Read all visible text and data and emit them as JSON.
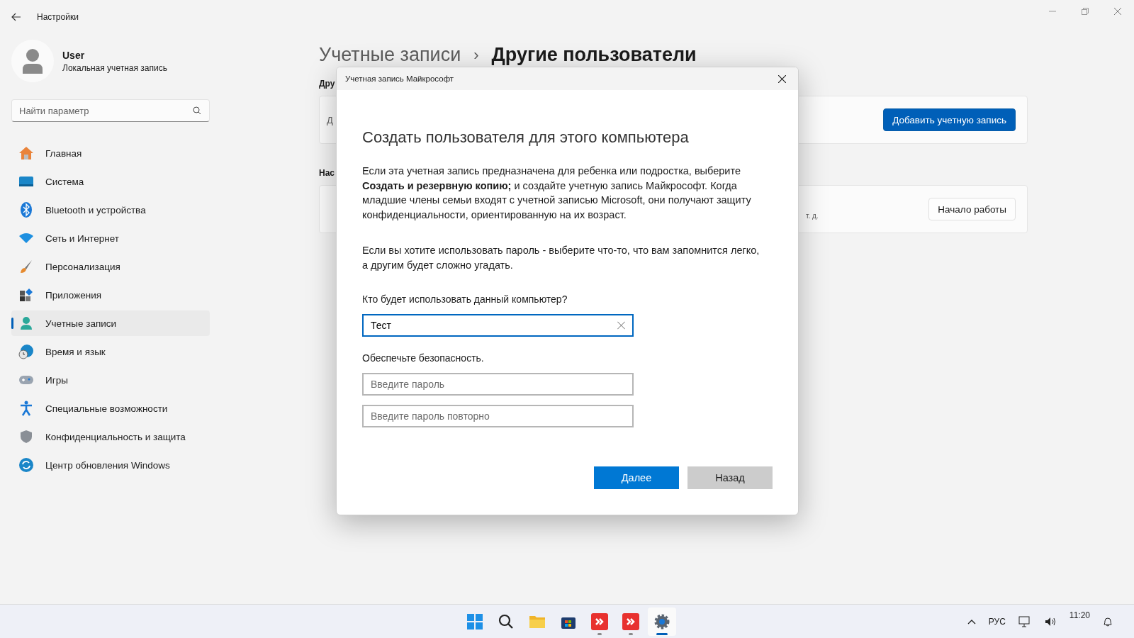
{
  "window": {
    "title": "Настройки"
  },
  "user": {
    "name": "User",
    "account_type": "Локальная учетная запись"
  },
  "search": {
    "placeholder": "Найти параметр"
  },
  "sidebar": {
    "items": [
      {
        "label": "Главная",
        "selected": false
      },
      {
        "label": "Система",
        "selected": false
      },
      {
        "label": "Bluetooth и устройства",
        "selected": false
      },
      {
        "label": "Сеть и Интернет",
        "selected": false
      },
      {
        "label": "Персонализация",
        "selected": false
      },
      {
        "label": "Приложения",
        "selected": false
      },
      {
        "label": "Учетные записи",
        "selected": true
      },
      {
        "label": "Время и язык",
        "selected": false
      },
      {
        "label": "Игры",
        "selected": false
      },
      {
        "label": "Специальные возможности",
        "selected": false
      },
      {
        "label": "Конфиденциальность и защита",
        "selected": false
      },
      {
        "label": "Центр обновления Windows",
        "selected": false
      }
    ]
  },
  "breadcrumb": {
    "parent": "Учетные записи",
    "separator": "›",
    "current": "Другие пользователи"
  },
  "sections": [
    {
      "heading": "Дру",
      "fragment": "Д",
      "button": {
        "label": "Добавить учетную запись",
        "kind": "primary"
      }
    },
    {
      "heading": "Нас",
      "fragment": "т. д.",
      "button": {
        "label": "Начало работы",
        "kind": "secondary"
      }
    }
  ],
  "dialog": {
    "title": "Учетная запись Майкрософт",
    "heading": "Создать пользователя для этого компьютера",
    "paragraphs": [
      "Если эта учетная запись предназначена для ребенка или подростка, выберите **Создать и резервную копию;** и создайте учетную запись Майкрософт. Когда младшие члены семьи входят с учетной записью Microsoft, они получают защиту конфиденциальности, ориентированную на их возраст.",
      "Если вы хотите использовать пароль - выберите что-то, что вам запомнится легко, а другим будет сложно угадать."
    ],
    "name_label": "Кто будет использовать данный компьютер?",
    "name_value": "Тест",
    "security_label": "Обеспечьте безопасность.",
    "password_fields": [
      {
        "placeholder": "Введите пароль"
      },
      {
        "placeholder": "Введите пароль повторно"
      }
    ],
    "buttons": [
      {
        "label": "Далее",
        "kind": "primary"
      },
      {
        "label": "Назад",
        "kind": "secondary"
      }
    ]
  },
  "taskbar": {
    "apps": [
      {
        "selected": false,
        "running": false
      },
      {
        "selected": false,
        "running": false
      },
      {
        "selected": false,
        "running": false
      },
      {
        "selected": false,
        "running": false
      },
      {
        "selected": false,
        "running": true
      },
      {
        "selected": false,
        "running": true
      },
      {
        "selected": true,
        "running": true
      }
    ],
    "language": "РУС",
    "time": "11:20"
  }
}
